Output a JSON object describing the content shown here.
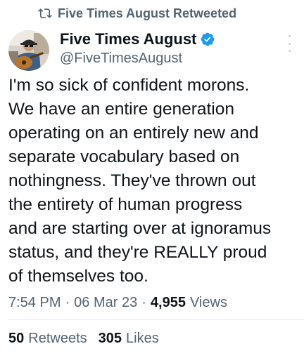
{
  "retweet": {
    "icon": "retweet-icon",
    "label": "Five Times August Retweeted"
  },
  "author": {
    "display_name": "Five Times August",
    "handle": "@FiveTimesAugust",
    "verified_icon": "verified-badge-icon",
    "verified_color": "#1d9bf0"
  },
  "menu_icon": "more-options-icon",
  "tweet": {
    "text": "I'm so sick of confident morons.\nWe have an entire generation\noperating on an entirely new and\nseparate  vocabulary based on\nnothingness. They've thrown out\nthe entirety of human progress\nand are starting over at ignoramus\nstatus, and they're REALLY proud\nof themselves too."
  },
  "meta": {
    "time": "7:54 PM",
    "separator": "·",
    "date": "06 Mar 23",
    "views_count": "4,955",
    "views_label": "Views"
  },
  "stats": {
    "retweets_count": "50",
    "retweets_label": "Retweets",
    "likes_count": "305",
    "likes_label": "Likes"
  },
  "colors": {
    "text_primary": "#0f1419",
    "text_secondary": "#536471",
    "accent": "#1d9bf0"
  }
}
